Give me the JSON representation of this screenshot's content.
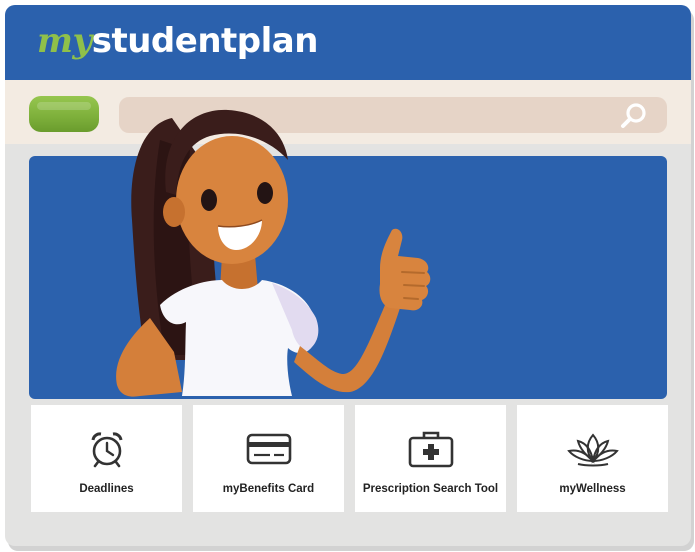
{
  "header": {
    "logo_prefix": "my",
    "logo_main": "studentplan"
  },
  "search": {
    "placeholder": "",
    "icon": "search-icon"
  },
  "colors": {
    "brand_blue": "#2b61ad",
    "brand_green": "#8fc04a",
    "search_bar": "#f3ebe2"
  },
  "tiles": [
    {
      "label": "Deadlines",
      "icon": "alarm-clock-icon"
    },
    {
      "label": "myBenefits Card",
      "icon": "credit-card-icon"
    },
    {
      "label": "Prescription Search Tool",
      "icon": "medical-kit-icon"
    },
    {
      "label": "myWellness",
      "icon": "lotus-icon"
    }
  ]
}
